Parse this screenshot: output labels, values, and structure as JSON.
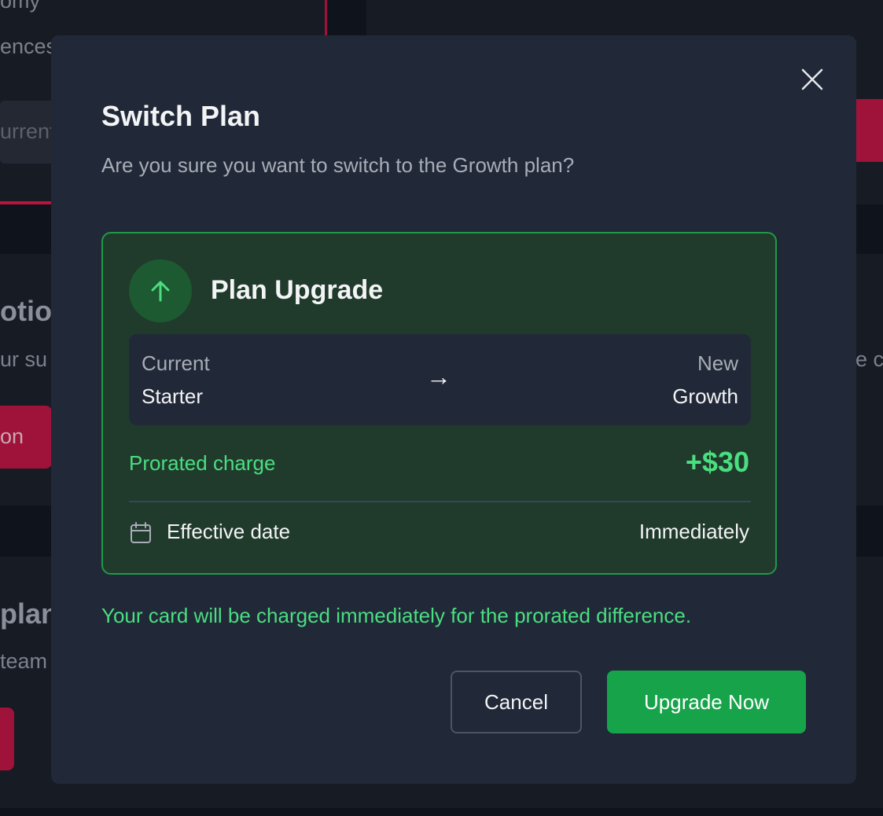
{
  "background": {
    "fragments": [
      "omy",
      "ences",
      "urrent",
      "otior",
      "ur su",
      "on",
      "e c",
      "plan",
      "team"
    ]
  },
  "modal": {
    "close_icon": "close-icon",
    "title": "Switch Plan",
    "subtitle": "Are you sure you want to switch to the Growth plan?",
    "upgrade_card": {
      "icon": "arrow-up-icon",
      "title": "Plan Upgrade",
      "current_label": "Current",
      "current_value": "Starter",
      "arrow": "→",
      "new_label": "New",
      "new_value": "Growth",
      "prorated_label": "Prorated charge",
      "prorated_value": "+$30",
      "effective_icon": "calendar-icon",
      "effective_label": "Effective date",
      "effective_value": "Immediately"
    },
    "note": "Your card will be charged immediately for the prorated difference.",
    "buttons": {
      "cancel": "Cancel",
      "confirm": "Upgrade Now"
    }
  },
  "colors": {
    "modal_bg": "#212938",
    "success": "#4ade80",
    "primary_button": "#16a34a",
    "card_bg": "#203b2c",
    "card_border": "#1f9a47",
    "background_accent": "#e11d48"
  }
}
